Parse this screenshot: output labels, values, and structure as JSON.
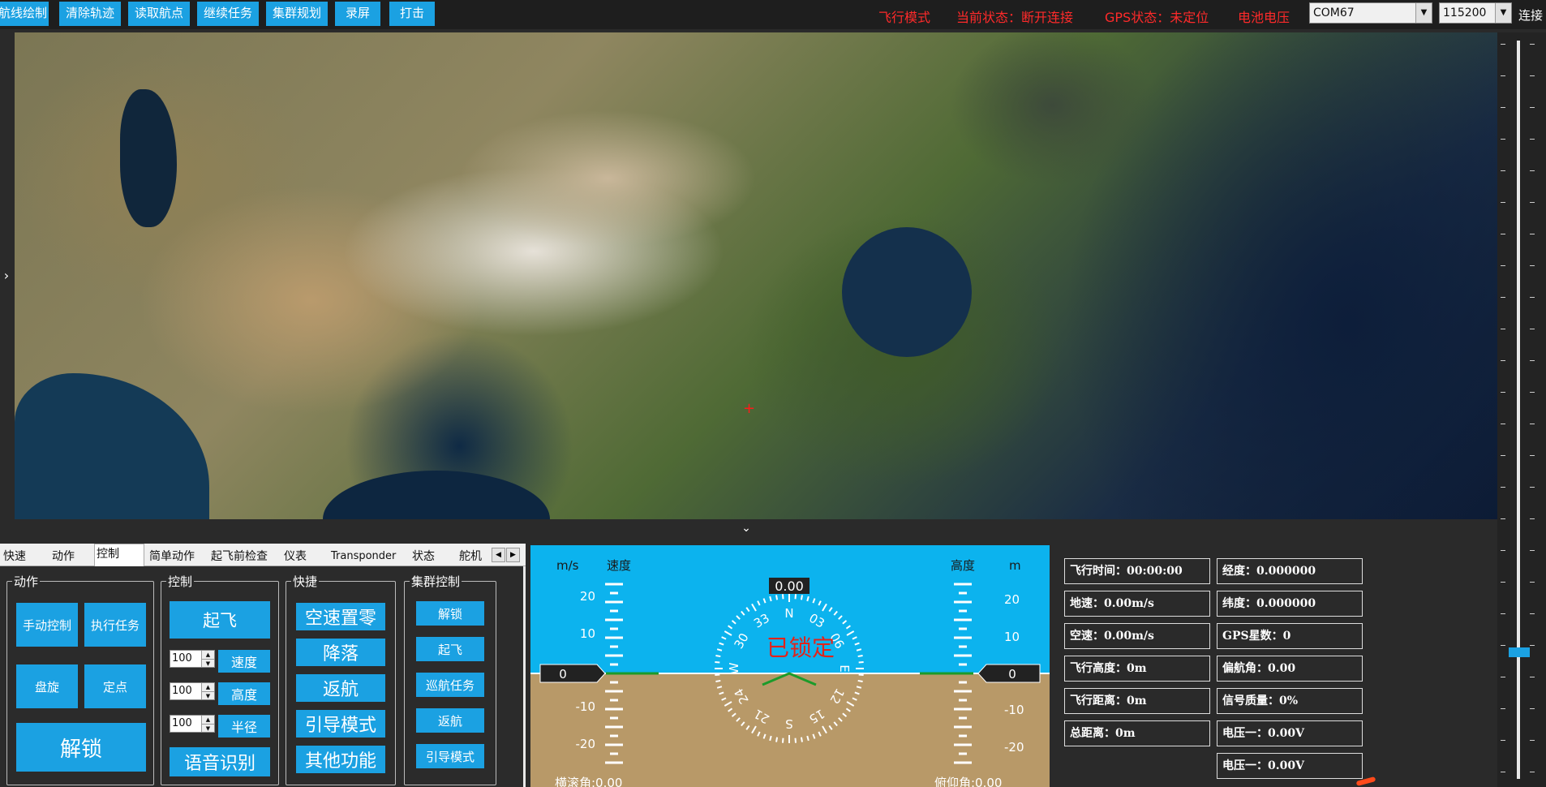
{
  "toolbar": {
    "buttons": [
      "航线绘制",
      "清除轨迹",
      "读取航点",
      "继续任务",
      "集群规划",
      "录屏",
      "打击"
    ],
    "status": {
      "flight_mode": "飞行模式",
      "current_state": "当前状态：断开连接",
      "gps_state": "GPS状态：未定位",
      "battery": "电池电压"
    },
    "port": "COM67",
    "baud": "115200",
    "connect": "连接"
  },
  "map": {
    "crosshair": "+",
    "expand_left": "›",
    "collapse_down": "⌄"
  },
  "tabs": {
    "items": [
      "快速",
      "动作",
      "控制",
      "简单动作",
      "起飞前检查",
      "仪表",
      "Transponder",
      "状态",
      "舵机"
    ],
    "active": "控制",
    "prev": "◀",
    "next": "▶"
  },
  "groups": {
    "action": {
      "title": "动作",
      "manual": "手动控制",
      "execute": "执行任务",
      "circle": "盘旋",
      "hold": "定点",
      "unlock": "解锁"
    },
    "control": {
      "title": "控制",
      "takeoff": "起飞",
      "speed_value": "100",
      "speed": "速度",
      "altitude_value": "100",
      "altitude": "高度",
      "radius_value": "100",
      "radius": "半径",
      "voice": "语音识别"
    },
    "shortcut": {
      "title": "快捷",
      "airspeed_zero": "空速置零",
      "land": "降落",
      "return": "返航",
      "guided": "引导模式",
      "other": "其他功能"
    },
    "swarm": {
      "title": "集群控制",
      "unlock": "解锁",
      "takeoff": "起飞",
      "patrol": "巡航任务",
      "return": "返航",
      "guided": "引导模式"
    }
  },
  "hud": {
    "speed_unit": "m/s",
    "speed_title": "速度",
    "alt_title": "高度",
    "alt_unit": "m",
    "heading_value": "0.00",
    "locked": "已锁定",
    "speed_value": "0",
    "alt_value": "0",
    "speed_ticks": [
      "20",
      "10",
      "-10",
      "-20"
    ],
    "alt_ticks": [
      "20",
      "10",
      "-10",
      "-20"
    ],
    "roll": "横滚角:0.00",
    "pitch": "俯仰角:0.00",
    "compass": [
      "N",
      "03",
      "06",
      "E",
      "12",
      "15",
      "S",
      "21",
      "24",
      "W",
      "30",
      "33"
    ],
    "colors": {
      "sky": "#0cb3ee",
      "ground": "#b89968",
      "horizon": "#ffffff",
      "marker": "#1c9b2a",
      "locked": "#e2231a"
    }
  },
  "info": {
    "flight_time": "飞行时间：00:00:00",
    "ground_speed": "地速：0.00m/s",
    "air_speed": "空速：0.00m/s",
    "flight_alt": "飞行高度：0m",
    "flight_dist": "飞行距离：0m",
    "total_dist": "总距离：0m",
    "longitude": "经度：0.000000",
    "latitude": "纬度：0.000000",
    "gps_sats": "GPS星数：0",
    "yaw": "偏航角：0.00",
    "signal": "信号质量：0%",
    "voltage1": "电压一：0.00V",
    "voltage2": "电压一：0.00V"
  }
}
